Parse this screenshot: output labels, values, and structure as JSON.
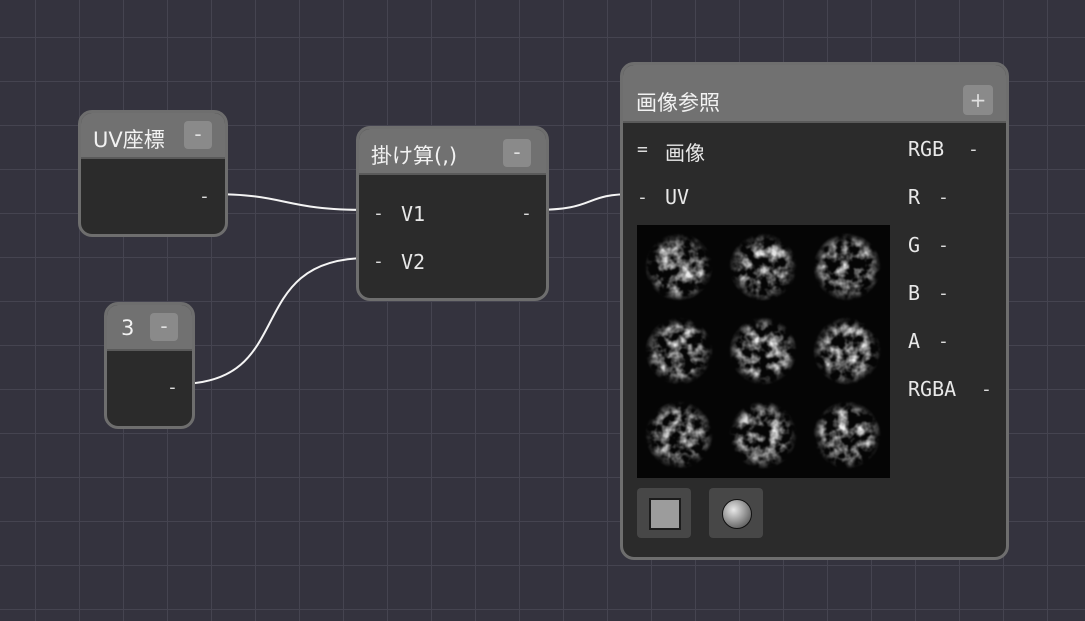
{
  "nodes": {
    "uv": {
      "title": "UV座標",
      "collapse": "-",
      "out_port": "-"
    },
    "const": {
      "title": "3",
      "collapse": "-",
      "out_port": "-"
    },
    "multiply": {
      "title": "掛け算(,)",
      "collapse": "-",
      "inputs": [
        {
          "port": "-",
          "label": "V1"
        },
        {
          "port": "-",
          "label": "V2"
        }
      ],
      "out_port": "-"
    },
    "image": {
      "title": "画像参照",
      "add": "+",
      "image_input": {
        "port": "=",
        "label": "画像"
      },
      "uv_input": {
        "port": "-",
        "label": "UV"
      },
      "outputs": [
        {
          "label": "RGB",
          "port": "-"
        },
        {
          "label": "R",
          "port": "-"
        },
        {
          "label": "G",
          "port": "-"
        },
        {
          "label": "B",
          "port": "-"
        },
        {
          "label": "A",
          "port": "-"
        },
        {
          "label": "RGBA",
          "port": "-"
        }
      ],
      "preview_icon": "tiled-noise-texture-preview",
      "mode_buttons": [
        "plane-preview-icon",
        "sphere-preview-icon"
      ]
    }
  },
  "colors": {
    "canvas": "#34333e",
    "grid": "#454450",
    "node_body": "#2b2b2b",
    "node_header": "#717171",
    "wire": "#ffffff"
  }
}
